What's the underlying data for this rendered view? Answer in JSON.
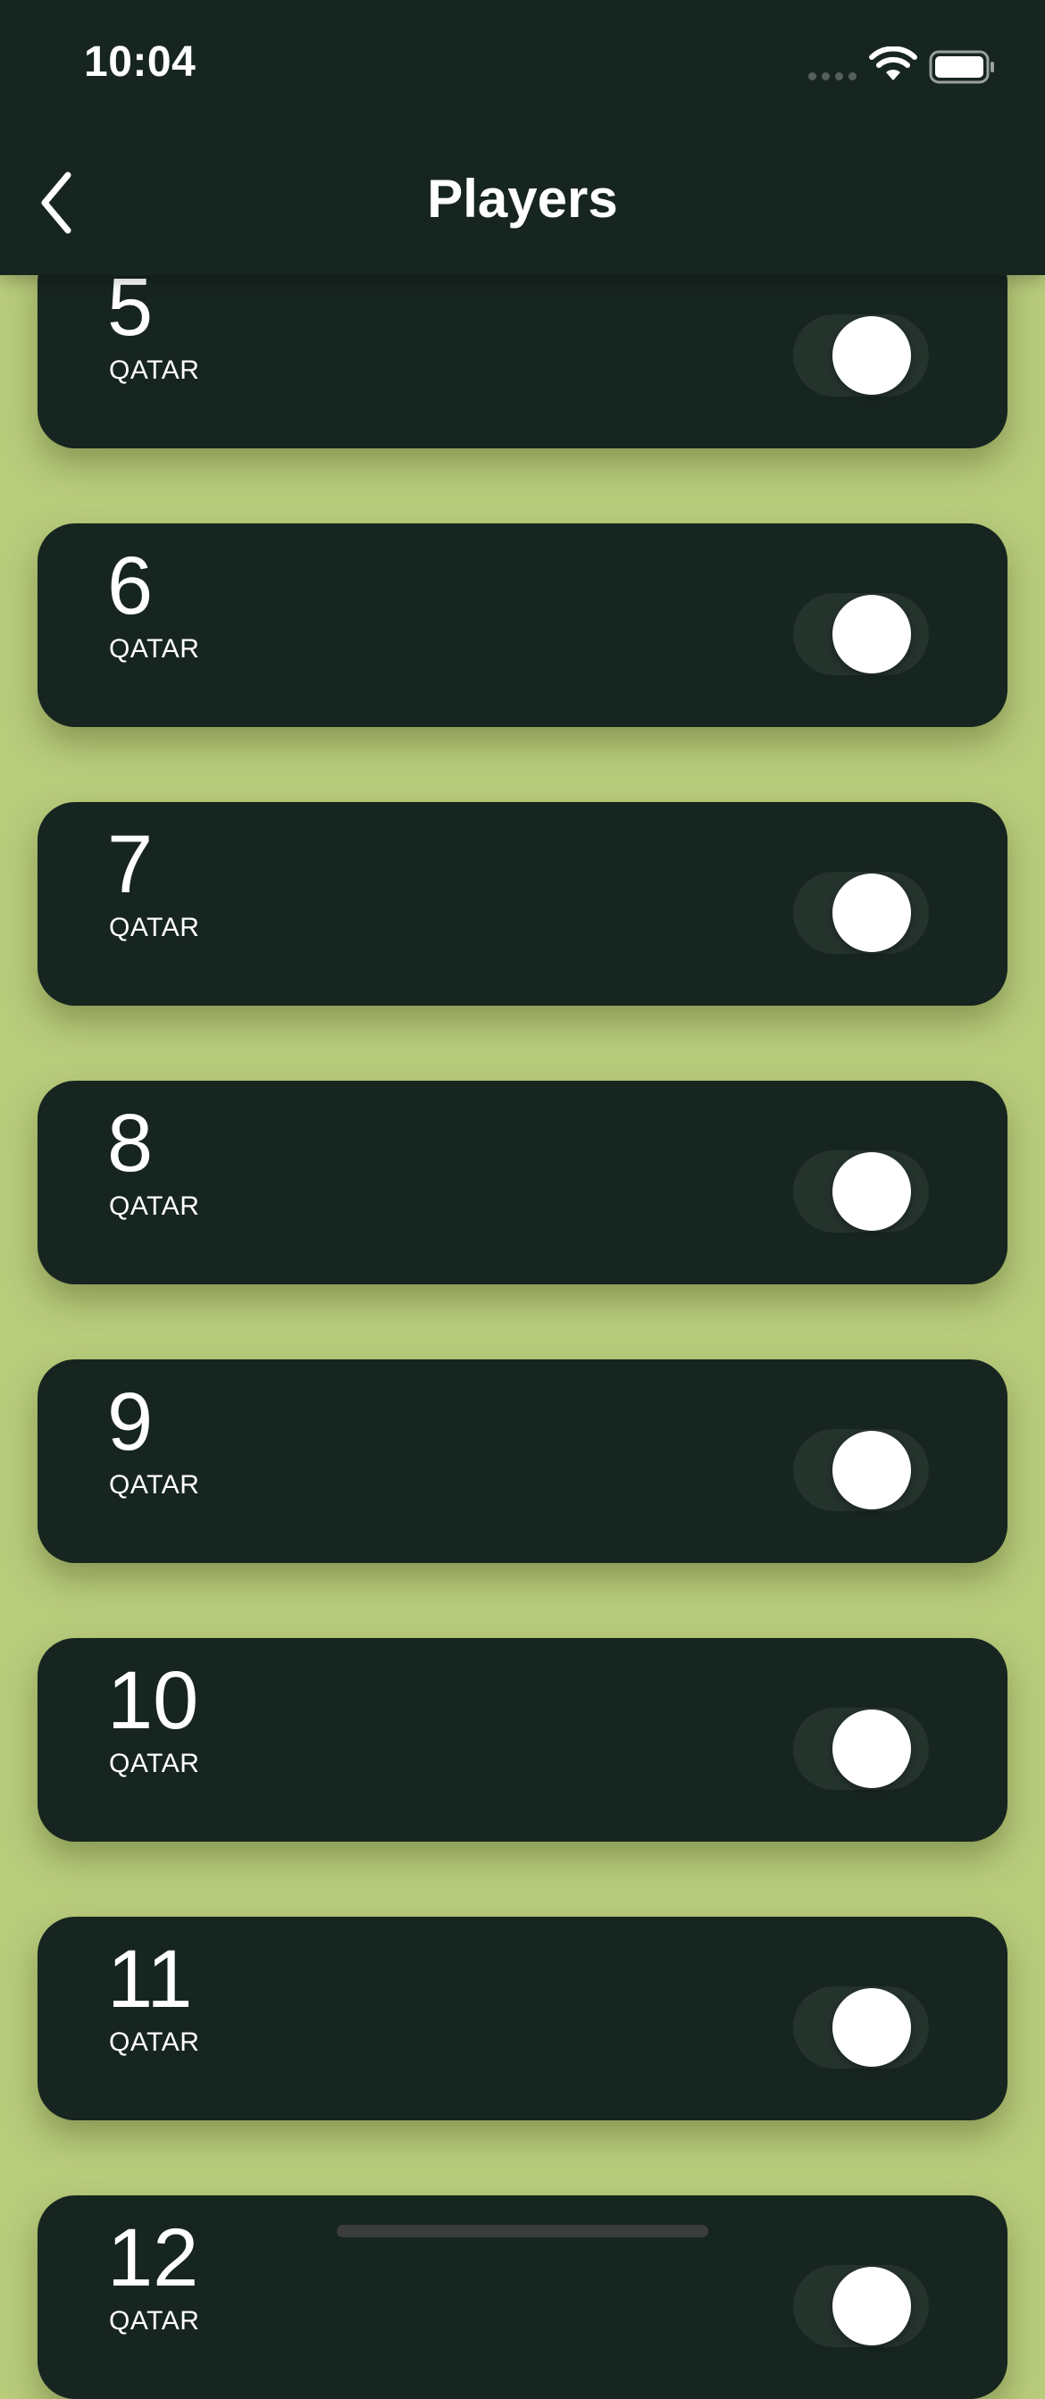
{
  "status_bar": {
    "time": "10:04",
    "icons": [
      "cellular-icon",
      "wifi-icon",
      "battery-icon"
    ]
  },
  "header": {
    "title": "Players",
    "back_icon": "chevron-left-icon"
  },
  "players": [
    {
      "number": "5",
      "country": "QATAR",
      "selected": false
    },
    {
      "number": "6",
      "country": "QATAR",
      "selected": false
    },
    {
      "number": "7",
      "country": "QATAR",
      "selected": false
    },
    {
      "number": "8",
      "country": "QATAR",
      "selected": false
    },
    {
      "number": "9",
      "country": "QATAR",
      "selected": false
    },
    {
      "number": "10",
      "country": "QATAR",
      "selected": false
    },
    {
      "number": "11",
      "country": "QATAR",
      "selected": false
    },
    {
      "number": "12",
      "country": "QATAR",
      "selected": false
    }
  ],
  "colors": {
    "background": "#b9cc7c",
    "card": "#172520",
    "header": "#172520",
    "toggle_off": "#25332d",
    "text": "#ffffff"
  }
}
